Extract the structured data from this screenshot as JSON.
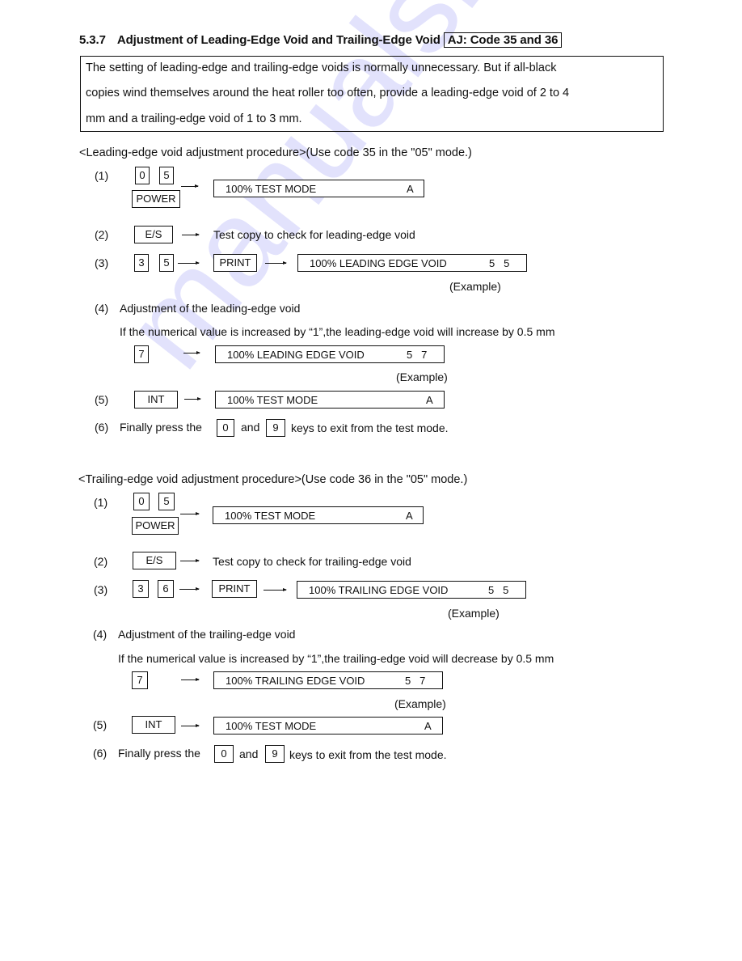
{
  "section": {
    "number": "5.3.7",
    "title": "Adjustment of Leading-Edge Void and Trailing-Edge Void",
    "code_label": "AJ: Code 35 and 36"
  },
  "intro": {
    "lines": [
      "The setting of leading-edge and trailing-edge voids is normally unnecessary. But if all-black",
      "copies wind themselves around the heat roller too often, provide a leading-edge void of 2 to 4",
      "mm and a trailing-edge void of 1 to 3 mm."
    ]
  },
  "watermark": "manualshive.com",
  "procedures": [
    {
      "heading": "<Leading-edge void adjustment procedure>(Use code 35 in the \"05\" mode.)",
      "step1": {
        "num": "(1)",
        "keys": [
          "0",
          "5"
        ],
        "power_key": "POWER",
        "display_text": "100% TEST MODE",
        "display_value": "A"
      },
      "step2": {
        "num": "(2)",
        "key": "E/S",
        "text": "Test copy to check for leading-edge void"
      },
      "step3": {
        "num": "(3)",
        "keys": [
          "3",
          "5"
        ],
        "print_key": "PRINT",
        "display_text": "100% LEADING EDGE VOID",
        "display_value": "5   5",
        "note": "(Example)"
      },
      "step4": {
        "num": "(4)",
        "title": "Adjustment of the leading-edge void",
        "desc": "If the numerical value is increased by “1”,the leading-edge void will increase by 0.5 mm",
        "key": "7",
        "display_text": "100% LEADING EDGE VOID",
        "display_value": "5   7",
        "note": "(Example)"
      },
      "step5": {
        "num": "(5)",
        "key": "INT",
        "display_text": "100% TEST MODE",
        "display_value": "A"
      },
      "step6": {
        "num": "(6)",
        "pre": "Finally press the",
        "key1": "0",
        "mid": "and",
        "key2": "9",
        "post": "keys to exit from the test mode."
      }
    },
    {
      "heading": "<Trailing-edge void adjustment procedure>(Use code 36 in the \"05\" mode.)",
      "step1": {
        "num": "(1)",
        "keys": [
          "0",
          "5"
        ],
        "power_key": "POWER",
        "display_text": "100% TEST MODE",
        "display_value": "A"
      },
      "step2": {
        "num": "(2)",
        "key": "E/S",
        "text": "Test copy to check for trailing-edge void"
      },
      "step3": {
        "num": "(3)",
        "keys": [
          "3",
          "6"
        ],
        "print_key": "PRINT",
        "display_text": "100% TRAILING EDGE VOID",
        "display_value": "5   5",
        "note": "(Example)"
      },
      "step4": {
        "num": "(4)",
        "title": "Adjustment of the trailing-edge void",
        "desc": "If the numerical value is increased by “1”,the trailing-edge void will decrease by 0.5 mm",
        "key": "7",
        "display_text": "100% TRAILING EDGE VOID",
        "display_value": "5   7",
        "note": "(Example)"
      },
      "step5": {
        "num": "(5)",
        "key": "INT",
        "display_text": "100% TEST MODE",
        "display_value": "A"
      },
      "step6": {
        "num": "(6)",
        "pre": "Finally press the",
        "key1": "0",
        "mid": "and",
        "key2": "9",
        "post": "keys to exit from the test mode."
      }
    }
  ]
}
